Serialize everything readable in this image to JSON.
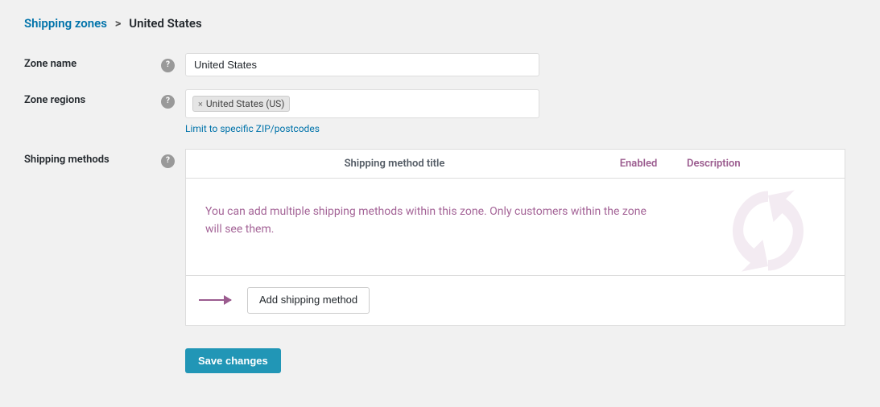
{
  "breadcrumb": {
    "link_text": "Shipping zones",
    "separator": ">",
    "current": "United States"
  },
  "zone_name": {
    "label": "Zone name",
    "value": "United States",
    "placeholder": ""
  },
  "zone_regions": {
    "label": "Zone regions",
    "tag": "United States (US)",
    "tag_remove_symbol": "×",
    "limit_link": "Limit to specific ZIP/postcodes"
  },
  "shipping_methods": {
    "label": "Shipping methods",
    "col_title": "Shipping method title",
    "col_enabled": "Enabled",
    "col_desc": "Description",
    "empty_text": "You can add multiple shipping methods within this zone. Only customers within the zone will see them.",
    "add_button": "Add shipping method"
  },
  "footer": {
    "save_button": "Save changes"
  },
  "colors": {
    "link": "#0073aa",
    "purple": "#9b5c8f",
    "save_bg": "#2196b6"
  }
}
